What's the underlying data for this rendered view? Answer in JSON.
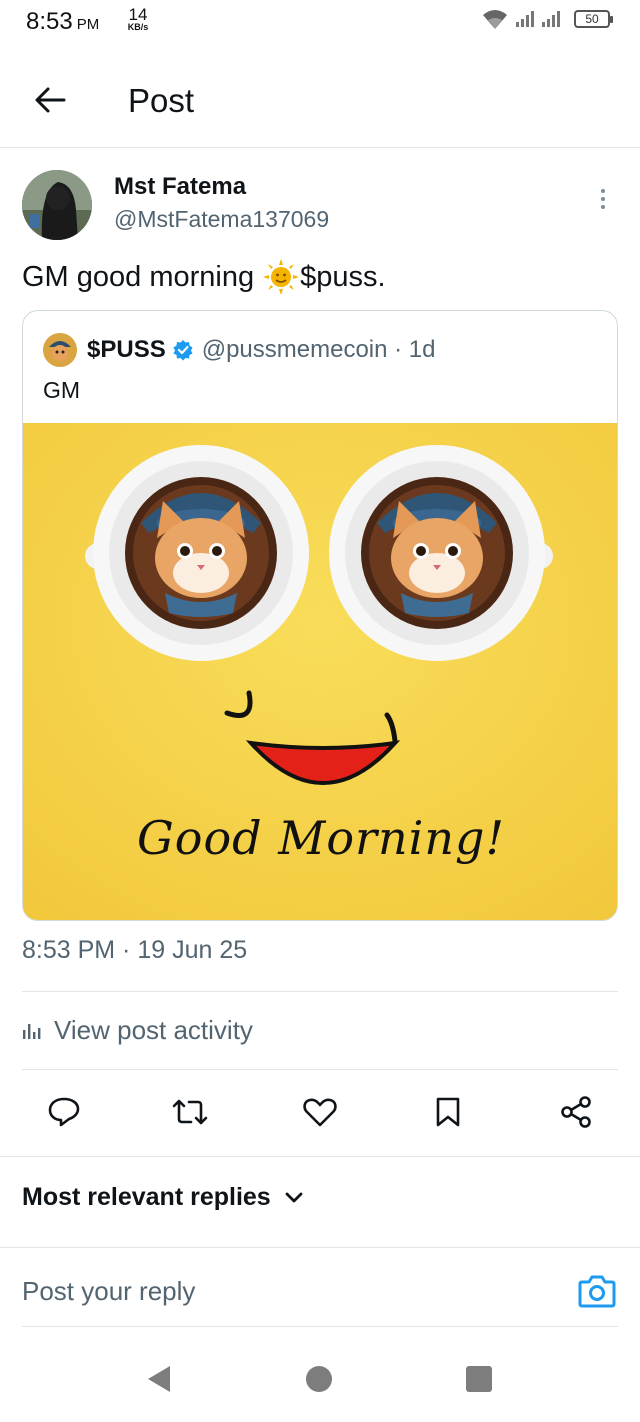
{
  "status_bar": {
    "time": "8:53",
    "ampm": "PM",
    "net_speed_value": "14",
    "net_speed_unit": "KB/s",
    "battery": "50"
  },
  "header": {
    "title": "Post"
  },
  "post": {
    "author_name": "Mst Fatema",
    "author_handle": "@MstFatema137069",
    "text_before": "GM good morning",
    "text_after": "$puss.",
    "timestamp": "8:53 PM · 19 Jun 25"
  },
  "quoted": {
    "name": "$PUSS",
    "handle_time": "@pussmemecoin · 1d",
    "text": "GM",
    "image_caption": "Good Morning!"
  },
  "activity": {
    "label": "View post activity"
  },
  "actions": [
    "reply",
    "repost",
    "like",
    "bookmark",
    "share"
  ],
  "replies": {
    "sort_label": "Most relevant replies"
  },
  "reply_box": {
    "placeholder": "Post your reply"
  },
  "colors": {
    "accent": "#1d9bf0",
    "text_secondary": "#536471",
    "media_background": "#f6d548"
  }
}
